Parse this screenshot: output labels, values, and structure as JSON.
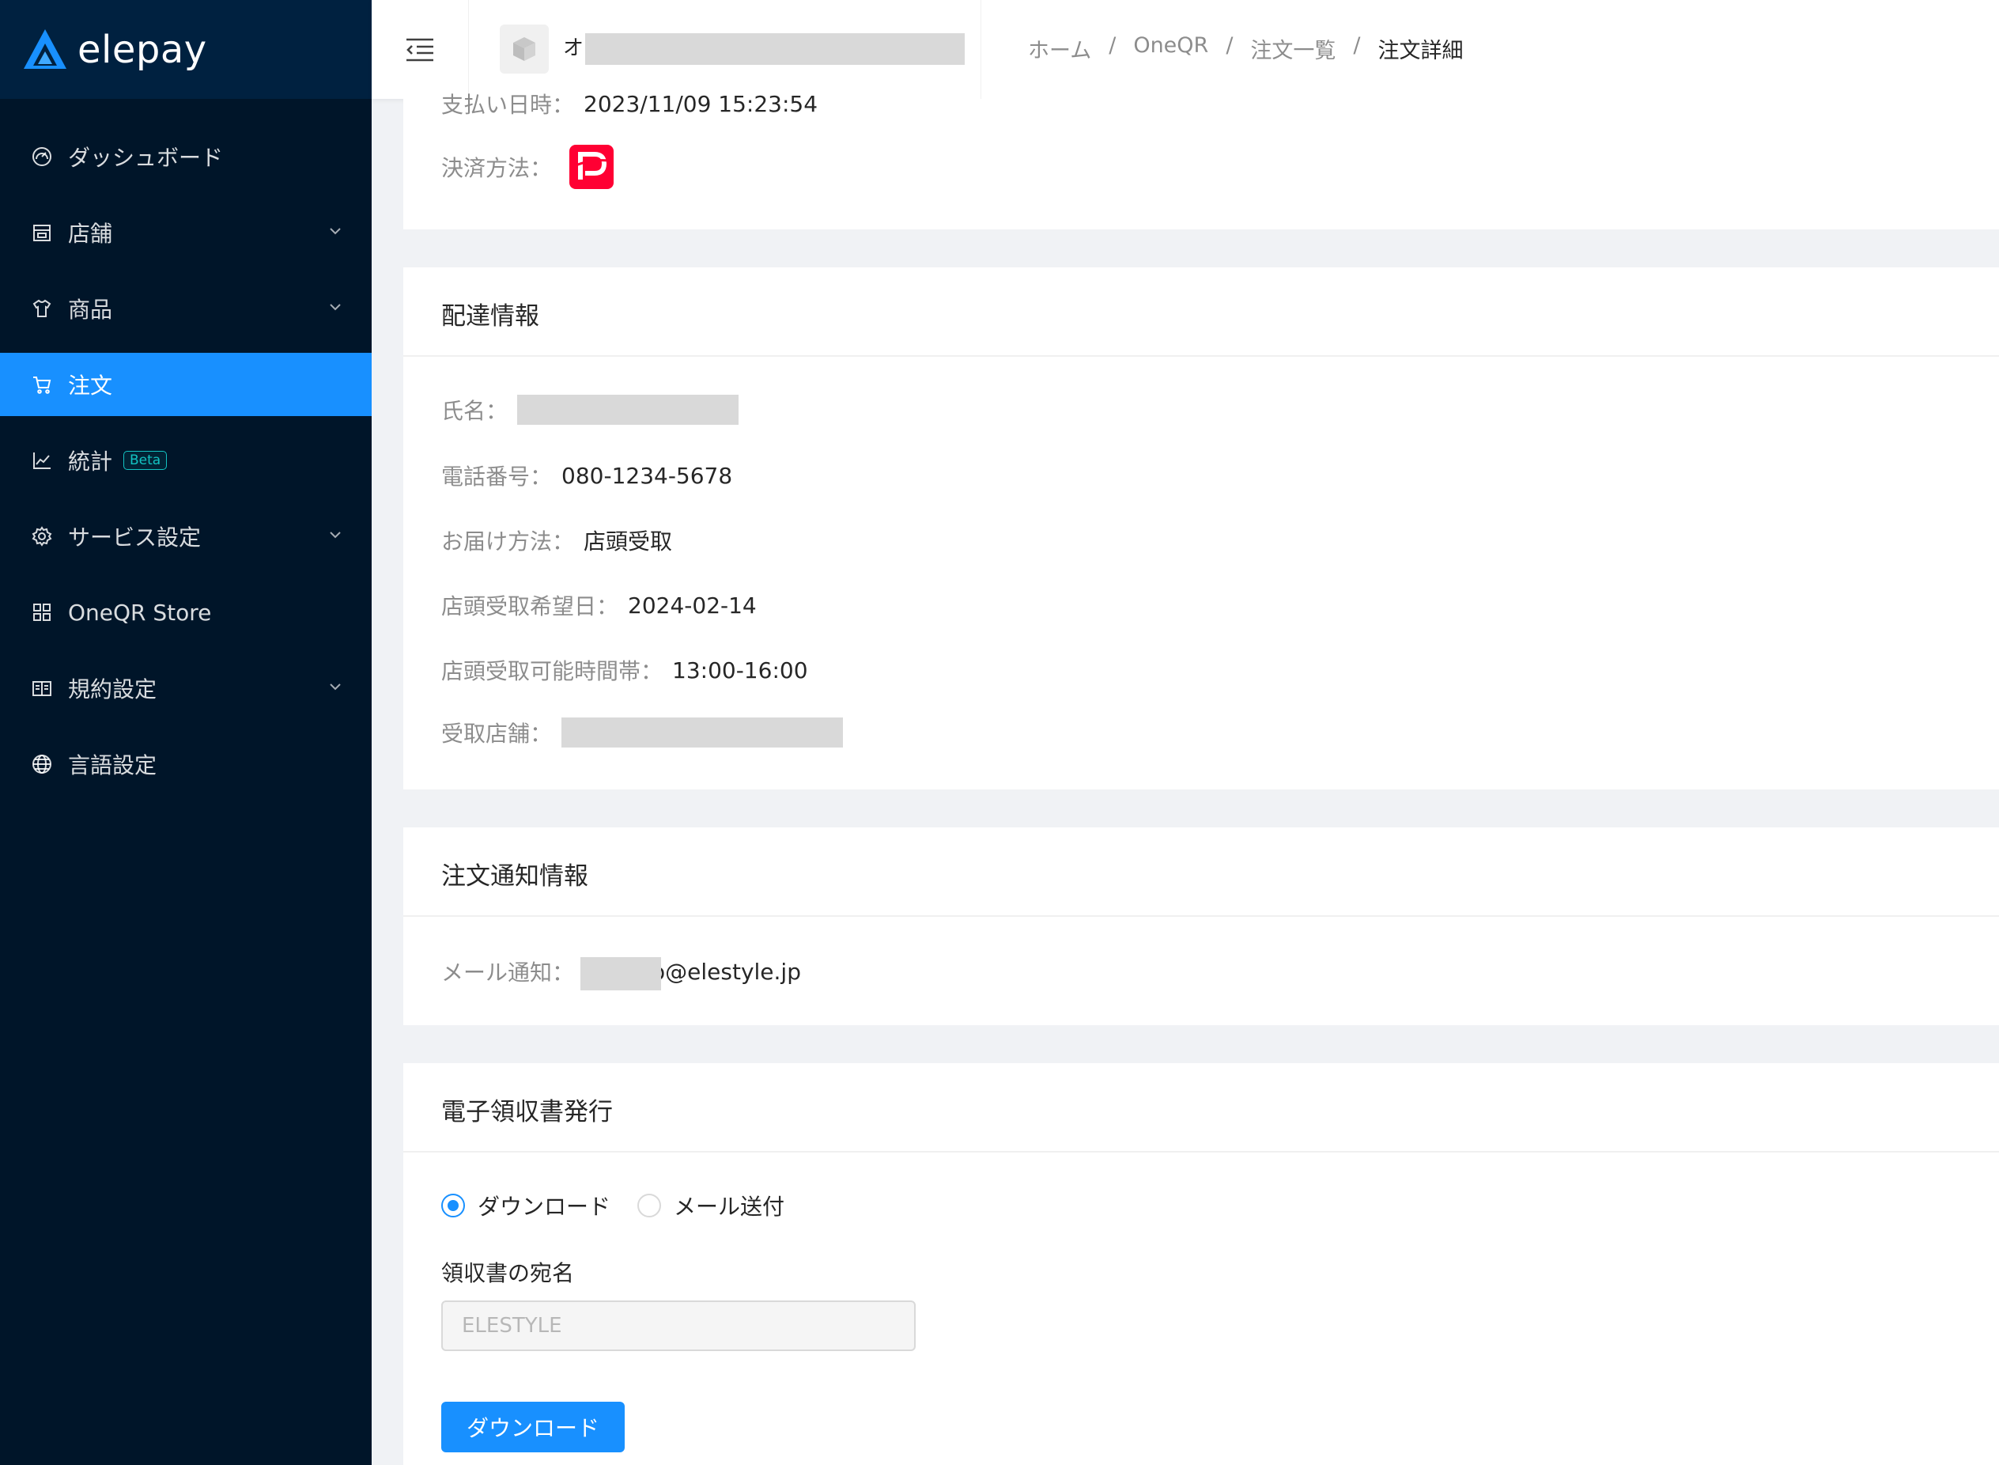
{
  "sidebar": {
    "logo_text": "elepay",
    "items": [
      {
        "label": "ダッシュボード"
      },
      {
        "label": "店舗"
      },
      {
        "label": "商品"
      },
      {
        "label": "注文"
      },
      {
        "label": "統計",
        "badge": "Beta"
      },
      {
        "label": "サービス設定"
      },
      {
        "label": "OneQR Store"
      },
      {
        "label": "規約設定"
      },
      {
        "label": "言語設定"
      }
    ]
  },
  "header": {
    "store_initial": "オ",
    "breadcrumb": [
      "ホーム",
      "OneQR",
      "注文一覧",
      "注文詳細"
    ],
    "separator": "/"
  },
  "payment_info": {
    "date_label": "支払い日時：",
    "date_value": "2023/11/09 15:23:54",
    "method_label": "決済方法：",
    "method_icon": "paypay-icon",
    "method_color": "#ff0033"
  },
  "delivery": {
    "title": "配達情報",
    "name_label": "氏名：",
    "phone_label": "電話番号：",
    "phone_value": "080-1234-5678",
    "method_label": "お届け方法：",
    "method_value": "店頭受取",
    "date_label": "店頭受取希望日：",
    "date_value": "2024-02-14",
    "time_label": "店頭受取可能時間帯：",
    "time_value": "13:00-16:00",
    "store_label": "受取店舗："
  },
  "notification": {
    "title": "注文通知情報",
    "email_label": "メール通知：",
    "email_suffix": "o@elestyle.jp"
  },
  "receipt": {
    "title": "電子領収書発行",
    "option_download": "ダウンロード",
    "option_email": "メール送付",
    "selected": "ダウンロード",
    "addressee_label": "領収書の宛名",
    "addressee_value": "ELESTYLE",
    "download_button": "ダウンロード"
  },
  "colors": {
    "sidebar_bg": "#001529",
    "accent": "#1890ff",
    "beta": "#13c2c2"
  }
}
